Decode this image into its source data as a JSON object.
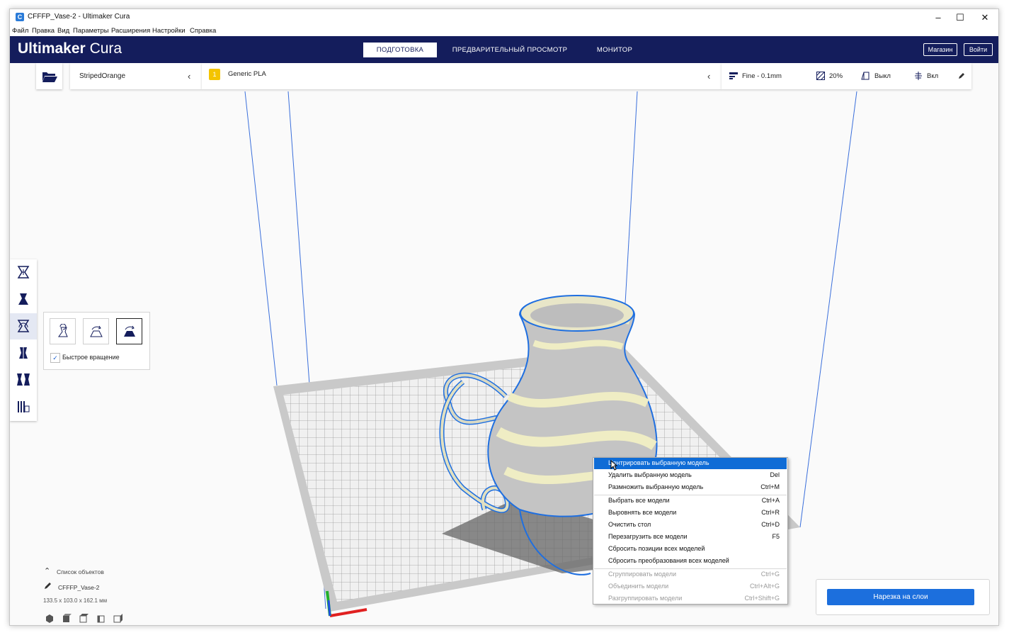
{
  "window": {
    "title": "CFFFP_Vase-2 - Ultimaker Cura",
    "app_icon_letter": "C",
    "controls": {
      "minimize": "–",
      "maximize": "☐",
      "close": "✕"
    }
  },
  "menubar": [
    "Файл",
    "Правка",
    "Вид",
    "Параметры",
    "Расширения",
    "Настройки",
    "Справка"
  ],
  "header": {
    "brand_main": "Ultimaker",
    "brand_sub": "Cura",
    "tabs": [
      {
        "label": "ПОДГОТОВКА",
        "active": true
      },
      {
        "label": "ПРЕДВАРИТЕЛЬНЫЙ ПРОСМОТР",
        "active": false
      },
      {
        "label": "МОНИТОР",
        "active": false
      }
    ],
    "marketplace": "Магазин",
    "signin": "Войти"
  },
  "selectors": {
    "printer": "StripedOrange",
    "extruder_number": "1",
    "material": "Generic PLA",
    "profile": "Fine - 0.1mm",
    "infill": "20%",
    "support": "Выкл",
    "adhesion": "Вкл"
  },
  "rotate_panel": {
    "lay_flat_label": "Быстрое вращение",
    "lay_flat_checked": true
  },
  "object_list": {
    "header": "Список объектов",
    "object_name": "CFFFP_Vase-2",
    "dimensions": "133.5 x 103.0 x 162.1 мм"
  },
  "context_menu": {
    "groups": [
      [
        {
          "label": "Центрировать выбранную модель",
          "shortcut": "",
          "highlighted": true,
          "disabled": false
        },
        {
          "label": "Удалить выбранную модель",
          "shortcut": "Del",
          "highlighted": false,
          "disabled": false
        },
        {
          "label": "Размножить выбранную модель",
          "shortcut": "Ctrl+M",
          "highlighted": false,
          "disabled": false
        }
      ],
      [
        {
          "label": "Выбрать все модели",
          "shortcut": "Ctrl+A",
          "highlighted": false,
          "disabled": false
        },
        {
          "label": "Выровнять все модели",
          "shortcut": "Ctrl+R",
          "highlighted": false,
          "disabled": false
        },
        {
          "label": "Очистить стол",
          "shortcut": "Ctrl+D",
          "highlighted": false,
          "disabled": false
        },
        {
          "label": "Перезагрузить все модели",
          "shortcut": "F5",
          "highlighted": false,
          "disabled": false
        },
        {
          "label": "Сбросить позиции всех моделей",
          "shortcut": "",
          "highlighted": false,
          "disabled": false
        },
        {
          "label": "Сбросить преобразования всех моделей",
          "shortcut": "",
          "highlighted": false,
          "disabled": false
        }
      ],
      [
        {
          "label": "Сгруппировать модели",
          "shortcut": "Ctrl+G",
          "highlighted": false,
          "disabled": true
        },
        {
          "label": "Объединить модели",
          "shortcut": "Ctrl+Alt+G",
          "highlighted": false,
          "disabled": true
        },
        {
          "label": "Разгруппировать модели",
          "shortcut": "Ctrl+Shift+G",
          "highlighted": false,
          "disabled": true
        }
      ]
    ]
  },
  "slice_button": "Нарезка на слои",
  "colors": {
    "header_bg": "#141d5c",
    "accent": "#1c6fdd",
    "selection_outline": "#1f6fe0",
    "material_badge": "#f4c400",
    "model_primary": "#c8c8c8",
    "model_stripe": "#f0eec6"
  }
}
